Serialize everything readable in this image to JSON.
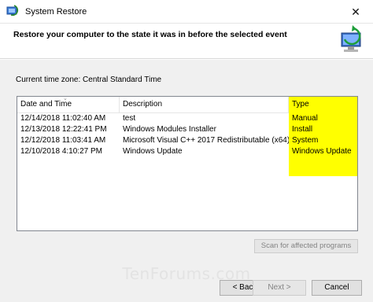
{
  "window": {
    "title": "System Restore",
    "close_glyph": "✕"
  },
  "header": {
    "heading": "Restore your computer to the state it was in before the selected event"
  },
  "timezone_label": "Current time zone: Central Standard Time",
  "table": {
    "columns": [
      "Date and Time",
      "Description",
      "Type"
    ],
    "rows": [
      {
        "date": "12/14/2018 11:02:40 AM",
        "description": "test",
        "type": "Manual"
      },
      {
        "date": "12/13/2018 12:22:41 PM",
        "description": "Windows Modules Installer",
        "type": "Install"
      },
      {
        "date": "12/12/2018 11:03:41 AM",
        "description": "Microsoft Visual C++ 2017 Redistributable (x64) ...",
        "type": "System"
      },
      {
        "date": "12/10/2018 4:10:27 PM",
        "description": "Windows Update",
        "type": "Windows Update"
      }
    ],
    "type_highlight_color": "#ffff00"
  },
  "scan_button": "Scan for affected programs",
  "watermark": "TenForums.com",
  "buttons": {
    "back": "< Back",
    "next": "Next >",
    "cancel": "Cancel"
  }
}
